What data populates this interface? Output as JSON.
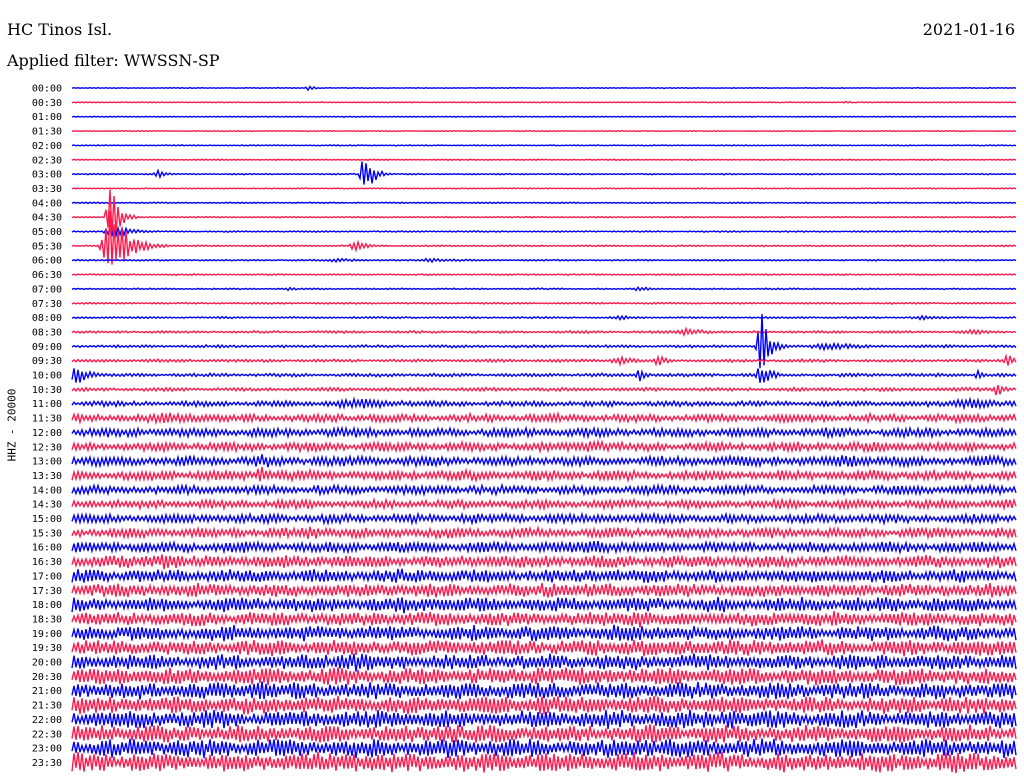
{
  "header": {
    "station": "HC Tinos Isl.",
    "date": "2021-01-16",
    "filter": "Applied filter: WWSSN-SP",
    "channel": "HHZ - 20000"
  },
  "colors": {
    "trace_a": "#0000ff",
    "trace_b": "#ff1a4d"
  },
  "chart_data": {
    "type": "line",
    "title": "HC Tinos Isl.",
    "subtitle": "Applied filter: WWSSN-SP",
    "ylabel": "HHZ - 20000",
    "xlabel": "",
    "grid": false,
    "color_cycle": [
      "#0000ff",
      "#ff1a4d"
    ],
    "rows": [
      {
        "time": "00:00",
        "noise": 0.5,
        "events": [
          [
            0.25,
            2.5,
            0.005
          ]
        ]
      },
      {
        "time": "00:30",
        "noise": 0.5,
        "events": [
          [
            0.82,
            1.5,
            0.005
          ]
        ]
      },
      {
        "time": "01:00",
        "noise": 0.5,
        "events": []
      },
      {
        "time": "01:30",
        "noise": 0.5,
        "events": []
      },
      {
        "time": "02:00",
        "noise": 0.6,
        "events": []
      },
      {
        "time": "02:30",
        "noise": 0.6,
        "events": []
      },
      {
        "time": "03:00",
        "noise": 0.7,
        "events": [
          [
            0.09,
            4,
            0.008
          ],
          [
            0.31,
            24,
            0.006
          ]
        ]
      },
      {
        "time": "03:30",
        "noise": 0.6,
        "events": []
      },
      {
        "time": "04:00",
        "noise": 0.7,
        "events": []
      },
      {
        "time": "04:30",
        "noise": 0.7,
        "events": [
          [
            0.04,
            36,
            0.006
          ]
        ]
      },
      {
        "time": "05:00",
        "noise": 0.8,
        "events": [
          [
            0.045,
            6,
            0.015
          ]
        ]
      },
      {
        "time": "05:30",
        "noise": 0.8,
        "events": [
          [
            0.04,
            40,
            0.012
          ],
          [
            0.3,
            6,
            0.008
          ]
        ]
      },
      {
        "time": "06:00",
        "noise": 0.8,
        "events": [
          [
            0.28,
            2,
            0.02
          ],
          [
            0.38,
            2,
            0.03
          ]
        ]
      },
      {
        "time": "06:30",
        "noise": 0.8,
        "events": []
      },
      {
        "time": "07:00",
        "noise": 0.8,
        "events": [
          [
            0.23,
            3,
            0.005
          ],
          [
            0.6,
            2.5,
            0.01
          ]
        ]
      },
      {
        "time": "07:30",
        "noise": 0.9,
        "events": []
      },
      {
        "time": "08:00",
        "noise": 1.0,
        "events": [
          [
            0.58,
            3,
            0.01
          ],
          [
            0.9,
            2.5,
            0.02
          ]
        ]
      },
      {
        "time": "08:30",
        "noise": 1.3,
        "events": [
          [
            0.65,
            3.5,
            0.02
          ],
          [
            0.95,
            3,
            0.02
          ]
        ]
      },
      {
        "time": "09:00",
        "noise": 1.5,
        "events": [
          [
            0.73,
            36,
            0.006
          ],
          [
            0.8,
            4,
            0.03
          ]
        ]
      },
      {
        "time": "09:30",
        "noise": 1.6,
        "events": [
          [
            0.58,
            4,
            0.015
          ],
          [
            0.62,
            9,
            0.005
          ],
          [
            0.99,
            8,
            0.005
          ]
        ]
      },
      {
        "time": "10:00",
        "noise": 1.8,
        "events": [
          [
            0.005,
            10,
            0.01
          ],
          [
            0.6,
            9,
            0.005
          ],
          [
            0.73,
            12,
            0.008
          ],
          [
            0.96,
            6,
            0.005
          ]
        ]
      },
      {
        "time": "10:30",
        "noise": 2.0,
        "events": [
          [
            0.98,
            8,
            0.005
          ]
        ]
      },
      {
        "time": "11:00",
        "noise": 3.0,
        "events": [
          [
            0.3,
            6,
            0.05
          ],
          [
            0.95,
            5,
            0.05
          ]
        ]
      },
      {
        "time": "11:30",
        "noise": 4.5,
        "events": [
          [
            0.1,
            6,
            0.05
          ]
        ]
      },
      {
        "time": "12:00",
        "noise": 5.0,
        "events": [
          [
            0.3,
            5,
            0.05
          ]
        ]
      },
      {
        "time": "12:30",
        "noise": 5.0,
        "events": [
          [
            0.55,
            6,
            0.04
          ]
        ]
      },
      {
        "time": "13:00",
        "noise": 5.5,
        "events": [
          [
            0.2,
            8,
            0.02
          ],
          [
            0.82,
            7,
            0.03
          ]
        ]
      },
      {
        "time": "13:30",
        "noise": 5.5,
        "events": [
          [
            0.2,
            10,
            0.01
          ]
        ]
      },
      {
        "time": "14:00",
        "noise": 5.0,
        "events": [
          [
            0.26,
            6,
            0.01
          ]
        ]
      },
      {
        "time": "14:30",
        "noise": 5.0,
        "events": []
      },
      {
        "time": "15:00",
        "noise": 5.0,
        "events": [
          [
            0.42,
            6,
            0.03
          ]
        ]
      },
      {
        "time": "15:30",
        "noise": 5.5,
        "events": [
          [
            0.25,
            7,
            0.03
          ]
        ]
      },
      {
        "time": "16:00",
        "noise": 6.0,
        "events": [
          [
            0.55,
            7,
            0.05
          ]
        ]
      },
      {
        "time": "16:30",
        "noise": 7.0,
        "events": [
          [
            0.1,
            8,
            0.05
          ]
        ]
      },
      {
        "time": "17:00",
        "noise": 7.5,
        "events": [
          [
            0.35,
            8,
            0.05
          ]
        ]
      },
      {
        "time": "17:30",
        "noise": 7.5,
        "events": [
          [
            0.5,
            8,
            0.05
          ]
        ]
      },
      {
        "time": "18:00",
        "noise": 8.0,
        "events": [
          [
            0.35,
            9,
            0.05
          ]
        ]
      },
      {
        "time": "18:30",
        "noise": 8.0,
        "events": [
          [
            0.6,
            9,
            0.05
          ]
        ]
      },
      {
        "time": "19:00",
        "noise": 8.5,
        "events": [
          [
            0.58,
            10,
            0.05
          ]
        ]
      },
      {
        "time": "19:30",
        "noise": 9.0,
        "events": [
          [
            0.6,
            10,
            0.05
          ]
        ]
      },
      {
        "time": "20:00",
        "noise": 9.0,
        "events": [
          [
            0.3,
            10,
            0.05
          ]
        ]
      },
      {
        "time": "20:30",
        "noise": 9.5,
        "events": [
          [
            0.5,
            10,
            0.05
          ]
        ]
      },
      {
        "time": "21:00",
        "noise": 9.5,
        "events": [
          [
            0.2,
            10,
            0.05
          ]
        ]
      },
      {
        "time": "21:30",
        "noise": 10.0,
        "events": [
          [
            0.5,
            10,
            0.05
          ]
        ]
      },
      {
        "time": "22:00",
        "noise": 10.0,
        "events": [
          [
            0.7,
            10,
            0.05
          ]
        ]
      },
      {
        "time": "22:30",
        "noise": 10.0,
        "events": [
          [
            0.4,
            10,
            0.05
          ]
        ]
      },
      {
        "time": "23:00",
        "noise": 10.5,
        "events": [
          [
            0.6,
            10,
            0.05
          ]
        ]
      },
      {
        "time": "23:30",
        "noise": 11.0,
        "events": [
          [
            0.3,
            10,
            0.05
          ]
        ]
      }
    ]
  }
}
